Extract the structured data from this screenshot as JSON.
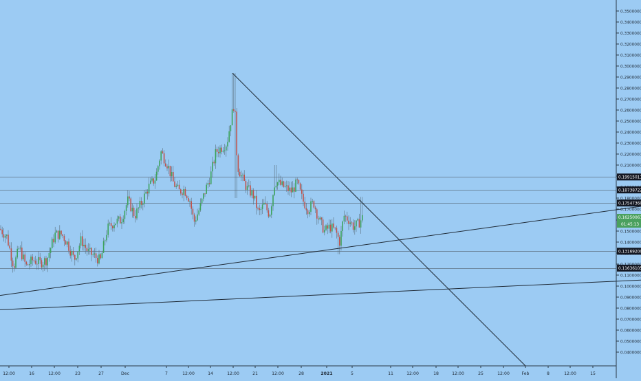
{
  "chart_data": {
    "type": "candlestick",
    "title": "",
    "xlabel": "",
    "ylabel": "",
    "ylim": [
      0.03,
      0.36
    ],
    "y_ticks": [
      0.35,
      0.34,
      0.33,
      0.32,
      0.31,
      0.3,
      0.29,
      0.28,
      0.27,
      0.26,
      0.25,
      0.24,
      0.23,
      0.22,
      0.21,
      0.2,
      0.19,
      0.18,
      0.17,
      0.16,
      0.15,
      0.14,
      0.13,
      0.12,
      0.11,
      0.1,
      0.09,
      0.08,
      0.07,
      0.06,
      0.05,
      0.04
    ],
    "y_tick_decimals": 8,
    "x_ticks": [
      "12:00",
      "16",
      "12:00",
      "23",
      "27",
      "Dec",
      "7",
      "12:00",
      "14",
      "12:00",
      "21",
      "12:00",
      "28",
      "2021",
      "5",
      "11",
      "12:00",
      "18",
      "12:00",
      "25",
      "12:00",
      "Feb",
      "8",
      "12:00",
      "15"
    ],
    "x_tick_bold": [
      "2021"
    ],
    "grid": false,
    "colors": {
      "background": "#9ccbf3",
      "up": "#3da35d",
      "down": "#c0524a",
      "wick": "#5a6f7e",
      "trendline": "#1f2a36",
      "level_line": "#5c6f80",
      "axis_text": "#1f2a36",
      "label_dark": "#131722",
      "label_text": "#ffffff",
      "last_price_bg": "#4aa05e"
    },
    "horizontal_levels": [
      {
        "price": 0.1991501,
        "label": "0.19915011"
      },
      {
        "price": 0.1873872,
        "label": "0.18738722"
      },
      {
        "price": 0.1754736,
        "label": "0.17547360"
      },
      {
        "price": 0.131692,
        "label": "0.13169200"
      },
      {
        "price": 0.1163611,
        "label": "0.11636105"
      }
    ],
    "last_price": {
      "price": 0.1625,
      "label": "0.16250061",
      "countdown": "01:45:13"
    },
    "trendlines": [
      {
        "x0": 0,
        "y0": 0.0915,
        "x1": 932,
        "y1": 0.1725
      },
      {
        "x0": 0,
        "y0": 0.0785,
        "x1": 932,
        "y1": 0.1055
      },
      {
        "x0": 0.2935,
        "y0": 0.2935,
        "x1": 0.03,
        "y1": 0.03
      }
    ],
    "price_path": [
      [
        0,
        0.152
      ],
      [
        10,
        0.145
      ],
      [
        20,
        0.118
      ],
      [
        28,
        0.135
      ],
      [
        38,
        0.118
      ],
      [
        48,
        0.124
      ],
      [
        58,
        0.121
      ],
      [
        68,
        0.124
      ],
      [
        80,
        0.147
      ],
      [
        90,
        0.147
      ],
      [
        98,
        0.139
      ],
      [
        108,
        0.124
      ],
      [
        118,
        0.142
      ],
      [
        128,
        0.131
      ],
      [
        138,
        0.127
      ],
      [
        146,
        0.123
      ],
      [
        156,
        0.152
      ],
      [
        166,
        0.158
      ],
      [
        176,
        0.16
      ],
      [
        186,
        0.178
      ],
      [
        196,
        0.164
      ],
      [
        206,
        0.176
      ],
      [
        216,
        0.19
      ],
      [
        226,
        0.198
      ],
      [
        234,
        0.222
      ],
      [
        244,
        0.21
      ],
      [
        252,
        0.194
      ],
      [
        260,
        0.186
      ],
      [
        268,
        0.188
      ],
      [
        276,
        0.178
      ],
      [
        282,
        0.158
      ],
      [
        290,
        0.17
      ],
      [
        298,
        0.186
      ],
      [
        306,
        0.2
      ],
      [
        314,
        0.222
      ],
      [
        322,
        0.226
      ],
      [
        330,
        0.23
      ],
      [
        336,
        0.252
      ],
      [
        341,
        0.268
      ],
      [
        345,
        0.21
      ],
      [
        352,
        0.198
      ],
      [
        360,
        0.188
      ],
      [
        368,
        0.183
      ],
      [
        376,
        0.166
      ],
      [
        384,
        0.174
      ],
      [
        392,
        0.165
      ],
      [
        400,
        0.196
      ],
      [
        408,
        0.192
      ],
      [
        416,
        0.189
      ],
      [
        424,
        0.186
      ],
      [
        432,
        0.194
      ],
      [
        440,
        0.178
      ],
      [
        448,
        0.17
      ],
      [
        456,
        0.176
      ],
      [
        464,
        0.16
      ],
      [
        472,
        0.15
      ],
      [
        480,
        0.154
      ],
      [
        488,
        0.15
      ],
      [
        494,
        0.14
      ],
      [
        500,
        0.164
      ],
      [
        508,
        0.16
      ],
      [
        514,
        0.154
      ],
      [
        520,
        0.156
      ],
      [
        528,
        0.163
      ]
    ]
  }
}
